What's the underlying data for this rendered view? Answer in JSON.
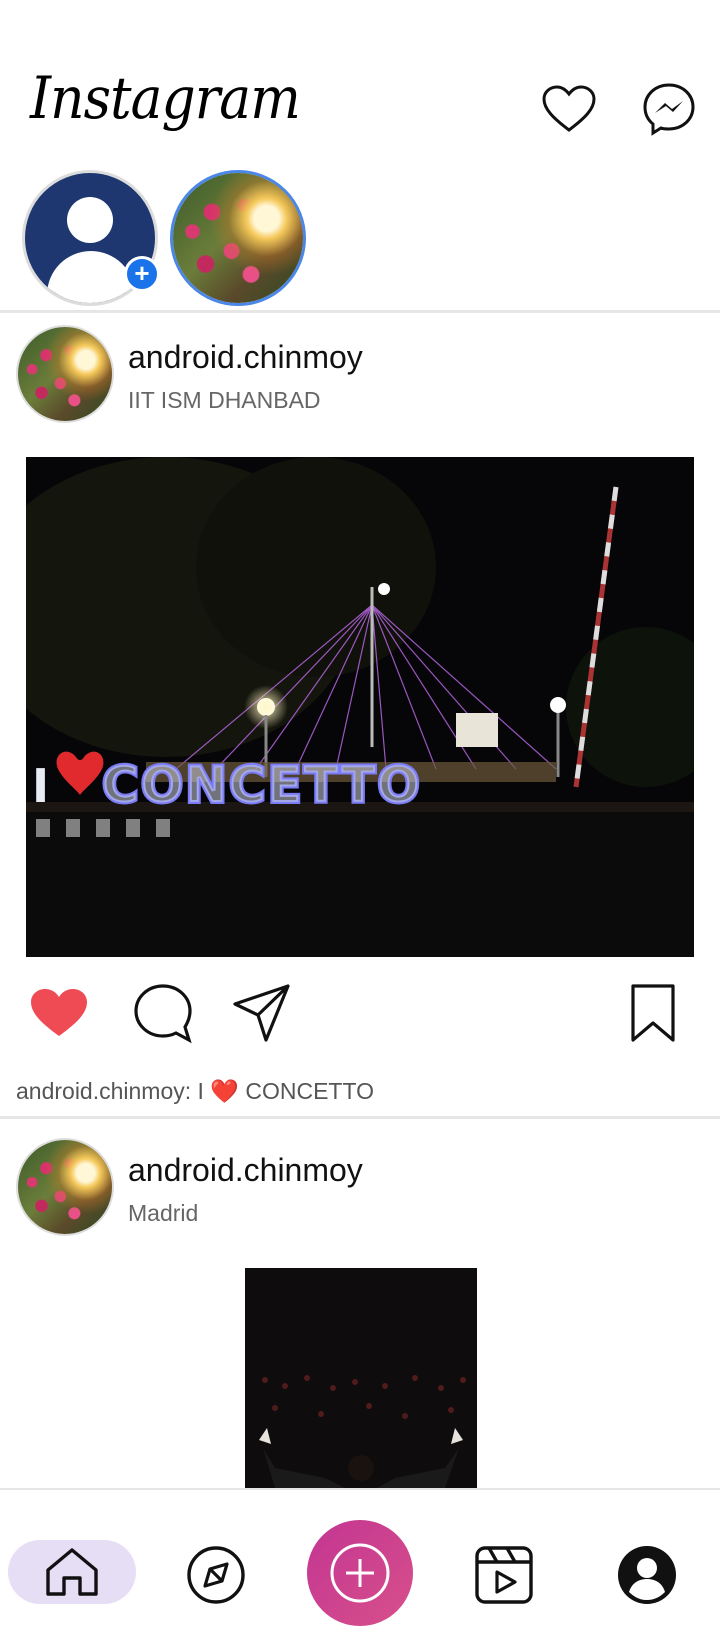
{
  "header": {
    "logo_text": "Instagram",
    "icons": [
      "heart-outline-icon",
      "messenger-icon"
    ]
  },
  "stories": [
    {
      "type": "own-profile",
      "badge": "+"
    },
    {
      "type": "story",
      "ring_color": "#4a87e6"
    }
  ],
  "posts": [
    {
      "username": "android.chinmoy",
      "location": "IIT ISM DHANBAD",
      "liked": true,
      "caption_user": "android.chinmoy:",
      "caption_prefix": "I",
      "caption_heart": "❤️",
      "caption_text": "CONCETTO",
      "image_text": "I ❤ CONCETTO"
    },
    {
      "username": "android.chinmoy",
      "location": "Madrid"
    }
  ],
  "bottom_nav": {
    "items": [
      "home",
      "explore",
      "add",
      "reels",
      "profile"
    ],
    "active": "home"
  },
  "colors": {
    "like_red": "#ef4b55",
    "add_button": "#c33593",
    "home_active_bg": "#e6def5",
    "story_ring": "#4a87e6",
    "add_badge": "#1a73e8"
  }
}
